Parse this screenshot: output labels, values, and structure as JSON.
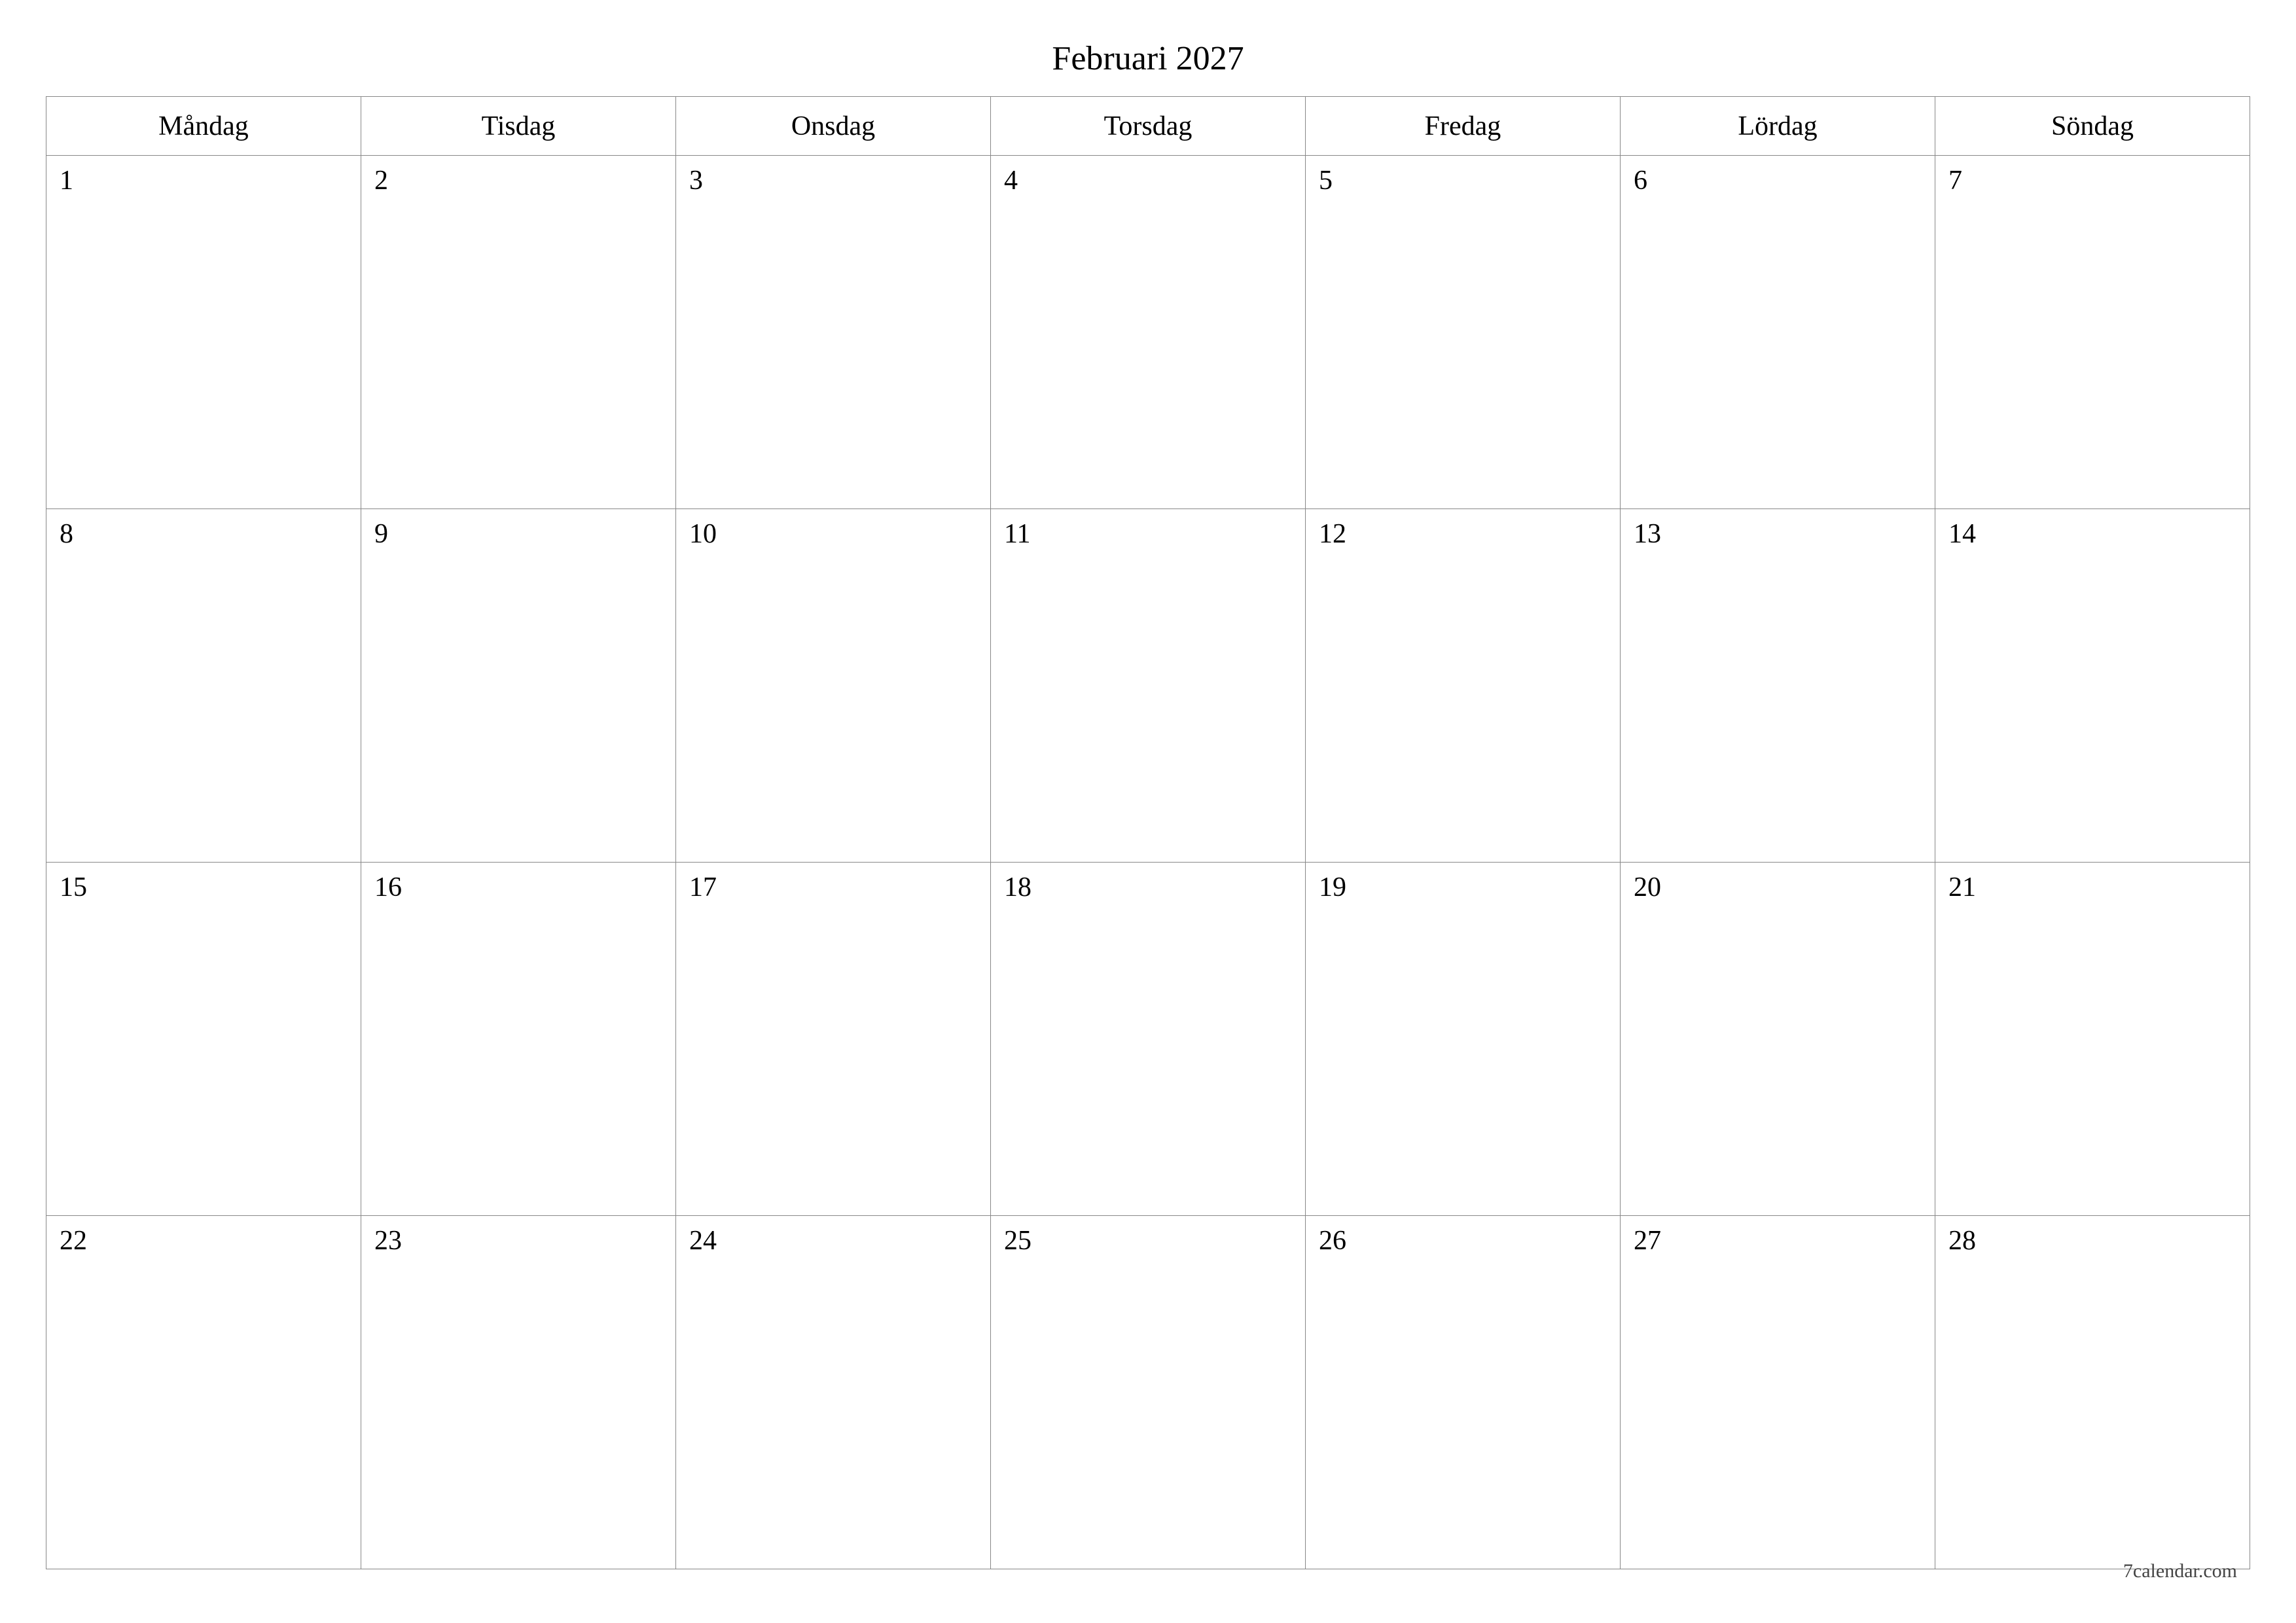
{
  "title": "Februari 2027",
  "weekdays": [
    "Måndag",
    "Tisdag",
    "Onsdag",
    "Torsdag",
    "Fredag",
    "Lördag",
    "Söndag"
  ],
  "weeks": [
    [
      "1",
      "2",
      "3",
      "4",
      "5",
      "6",
      "7"
    ],
    [
      "8",
      "9",
      "10",
      "11",
      "12",
      "13",
      "14"
    ],
    [
      "15",
      "16",
      "17",
      "18",
      "19",
      "20",
      "21"
    ],
    [
      "22",
      "23",
      "24",
      "25",
      "26",
      "27",
      "28"
    ]
  ],
  "footer": "7calendar.com"
}
